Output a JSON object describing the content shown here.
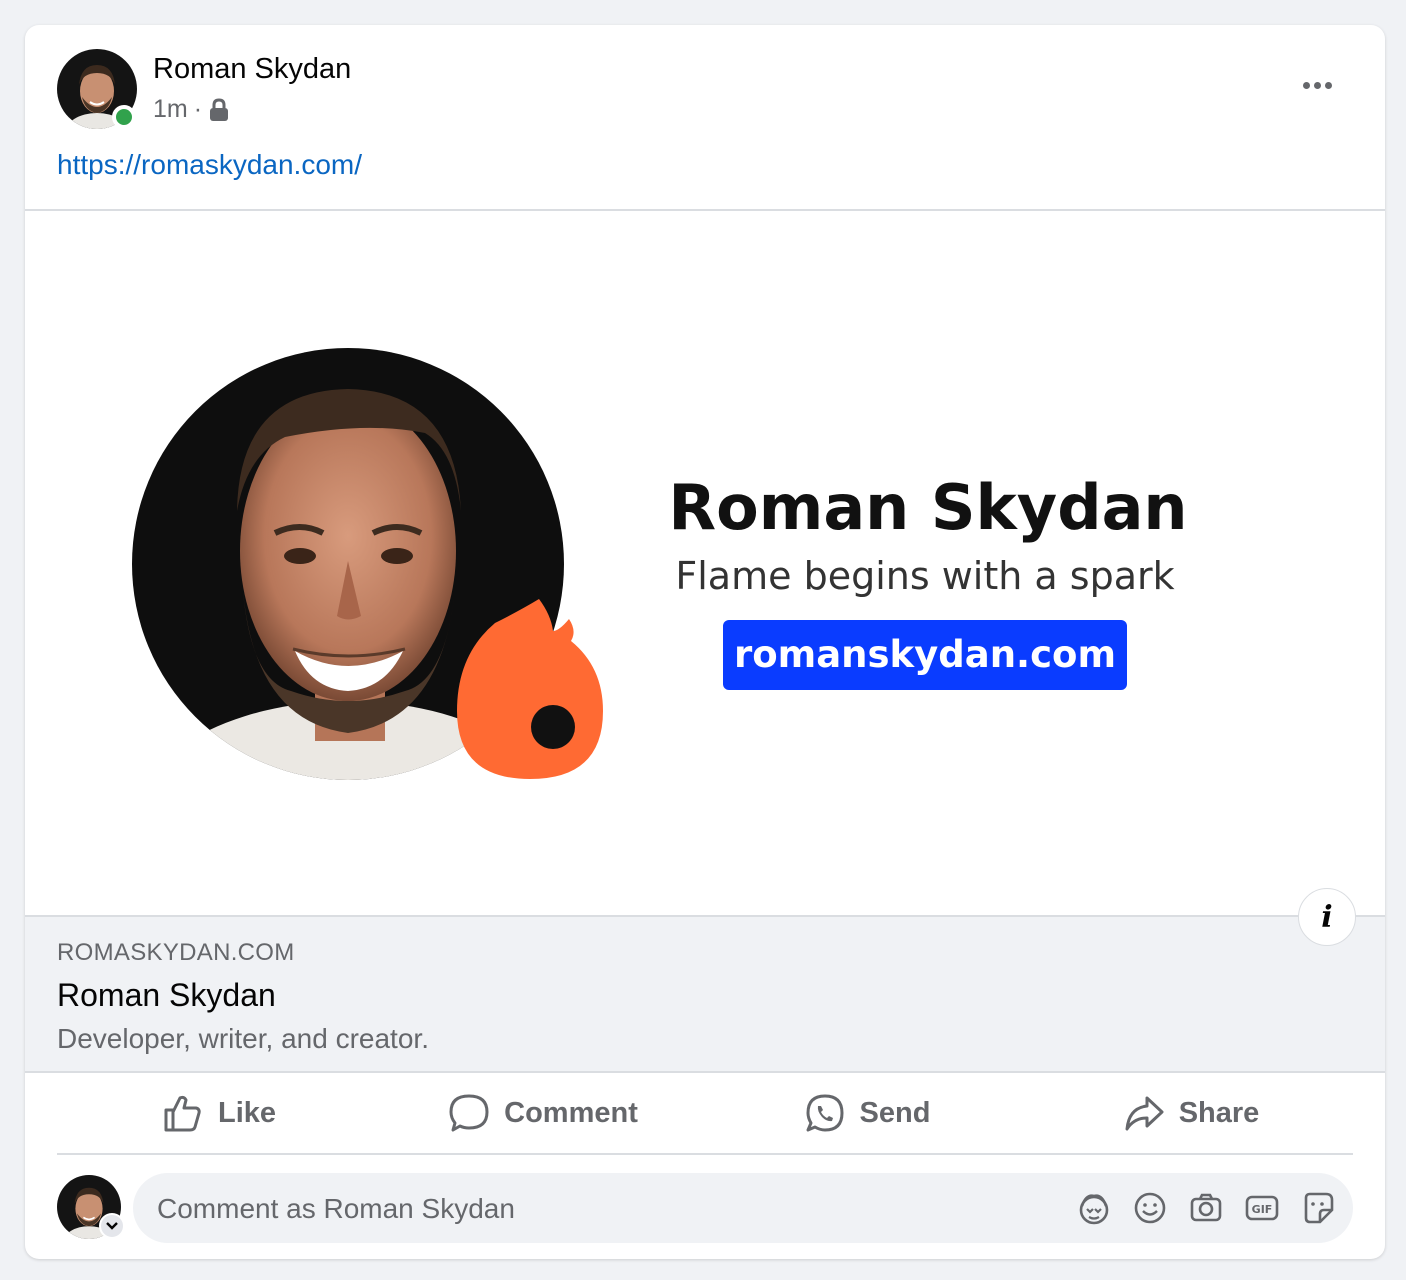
{
  "post": {
    "author": "Roman Skydan",
    "time": "1m",
    "separator": "·",
    "privacy_icon": "lock-icon",
    "link_text": "https://romaskydan.com/"
  },
  "preview_image": {
    "name": "Roman Skydan",
    "tagline": "Flame begins with a spark",
    "button": "romanskydan.com"
  },
  "link_meta": {
    "domain": "ROMASKYDAN.COM",
    "title": "Roman Skydan",
    "description": "Developer, writer, and creator."
  },
  "actions": [
    {
      "label": "Like",
      "icon": "thumbs-up-icon"
    },
    {
      "label": "Comment",
      "icon": "comment-bubble-icon"
    },
    {
      "label": "Send",
      "icon": "whatsapp-icon"
    },
    {
      "label": "Share",
      "icon": "share-arrow-icon"
    }
  ],
  "comment": {
    "placeholder": "Comment as Roman Skydan",
    "icons": [
      "avatar-sticker-icon",
      "emoji-icon",
      "camera-icon",
      "gif-icon",
      "sticker-icon"
    ]
  },
  "colors": {
    "link": "#0a66c2",
    "online": "#31a24c",
    "flame": "#ff6a33",
    "site_button": "#0a3cff",
    "muted_text": "#65676b"
  }
}
